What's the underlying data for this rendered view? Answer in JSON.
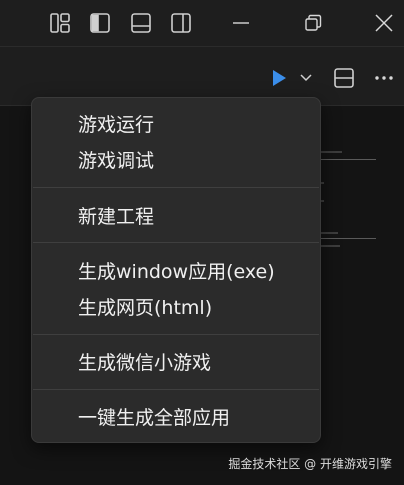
{
  "window_controls": {
    "icons": [
      "layout-customize-icon",
      "toggle-primary-sidebar-icon",
      "toggle-panel-icon",
      "toggle-secondary-sidebar-icon",
      "minimize-icon",
      "restore-icon",
      "close-icon"
    ]
  },
  "toolbar": {
    "icons": [
      "run-icon",
      "run-dropdown-chevron-icon",
      "split-editor-icon",
      "more-actions-icon"
    ],
    "accent_color": "#3b8eea"
  },
  "menu": {
    "items": [
      {
        "label": "游戏运行"
      },
      {
        "label": "游戏调试"
      },
      {
        "label": "新建工程"
      },
      {
        "label": "生成window应用(exe)"
      },
      {
        "label": "生成网页(html)"
      },
      {
        "label": "生成微信小游戏"
      },
      {
        "label": "一键生成全部应用"
      }
    ]
  },
  "watermark": "掘金技术社区 @ 开维游戏引擎"
}
